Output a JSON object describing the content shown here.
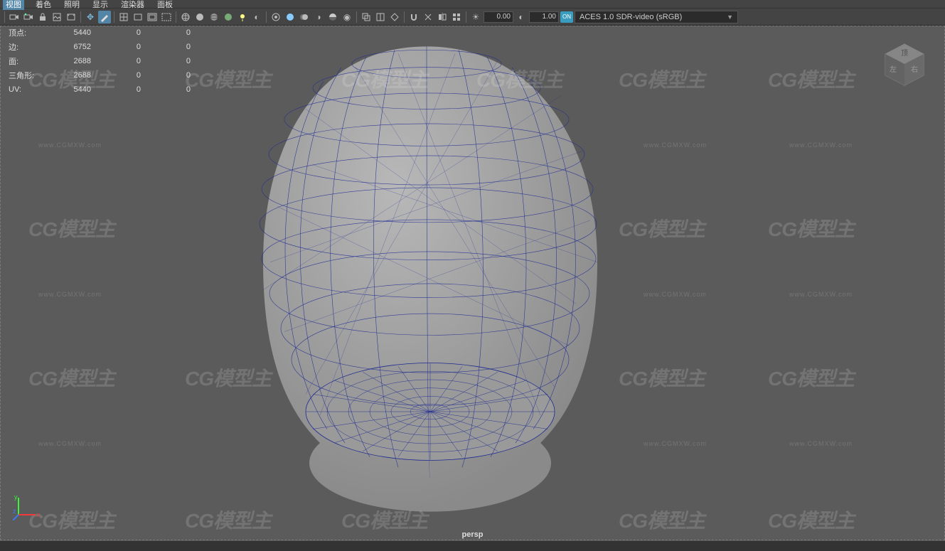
{
  "menubar": {
    "items": [
      "视图",
      "着色",
      "照明",
      "显示",
      "渲染器",
      "面板"
    ],
    "active_index": 0
  },
  "toolbar": {
    "num1": "0.00",
    "num2": "1.00",
    "color_space": "ACES 1.0 SDR-video (sRGB)",
    "on_label": "ON"
  },
  "hud": {
    "rows": [
      {
        "label": "顶点:",
        "c1": "5440",
        "c2": "0",
        "c3": "0"
      },
      {
        "label": "边:",
        "c1": "6752",
        "c2": "0",
        "c3": "0"
      },
      {
        "label": "面:",
        "c1": "2688",
        "c2": "0",
        "c3": "0"
      },
      {
        "label": "三角形:",
        "c1": "2688",
        "c2": "0",
        "c3": "0"
      },
      {
        "label": "UV:",
        "c1": "5440",
        "c2": "0",
        "c3": "0"
      }
    ]
  },
  "camera_label": "persp",
  "watermark": {
    "logo": "CG模型主",
    "url": "www.CGMXW.com"
  },
  "viewcube": {
    "top": "顶",
    "right": "右",
    "left": "左"
  }
}
